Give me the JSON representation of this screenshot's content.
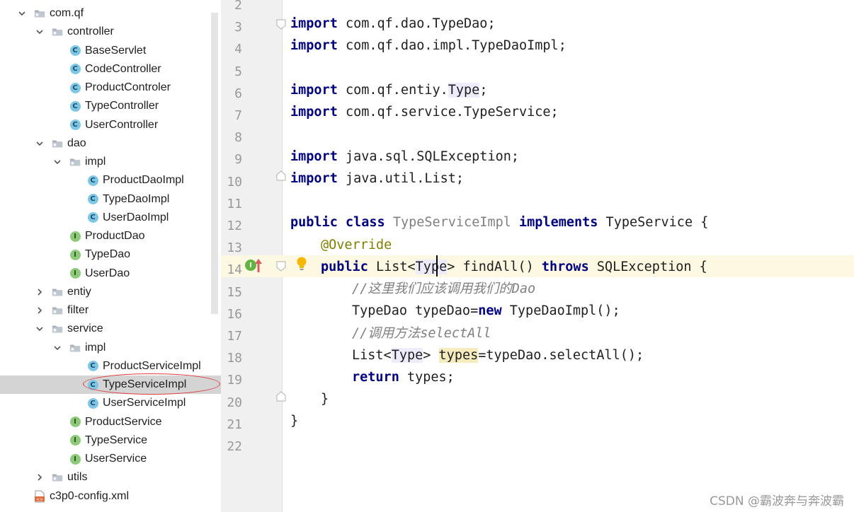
{
  "tree": {
    "items": [
      {
        "label": "com.qf",
        "kind": "package",
        "arrow": "down"
      },
      {
        "label": "controller",
        "kind": "package",
        "arrow": "down"
      },
      {
        "label": "BaseServlet",
        "kind": "class"
      },
      {
        "label": "CodeController",
        "kind": "class"
      },
      {
        "label": "ProductControler",
        "kind": "class"
      },
      {
        "label": "TypeController",
        "kind": "class"
      },
      {
        "label": "UserController",
        "kind": "class"
      },
      {
        "label": "dao",
        "kind": "package",
        "arrow": "down"
      },
      {
        "label": "impl",
        "kind": "package",
        "arrow": "down"
      },
      {
        "label": "ProductDaoImpl",
        "kind": "class"
      },
      {
        "label": "TypeDaoImpl",
        "kind": "class"
      },
      {
        "label": "UserDaoImpl",
        "kind": "class"
      },
      {
        "label": "ProductDao",
        "kind": "interface"
      },
      {
        "label": "TypeDao",
        "kind": "interface"
      },
      {
        "label": "UserDao",
        "kind": "interface"
      },
      {
        "label": "entiy",
        "kind": "package",
        "arrow": "right"
      },
      {
        "label": "filter",
        "kind": "package",
        "arrow": "right"
      },
      {
        "label": "service",
        "kind": "package",
        "arrow": "down"
      },
      {
        "label": "impl",
        "kind": "package",
        "arrow": "down"
      },
      {
        "label": "ProductServiceImpl",
        "kind": "class"
      },
      {
        "label": "TypeServiceImpl",
        "kind": "class",
        "selected": true
      },
      {
        "label": "UserServiceImpl",
        "kind": "class"
      },
      {
        "label": "ProductService",
        "kind": "interface"
      },
      {
        "label": "TypeService",
        "kind": "interface"
      },
      {
        "label": "UserService",
        "kind": "interface"
      },
      {
        "label": "utils",
        "kind": "package",
        "arrow": "right"
      },
      {
        "label": "c3p0-config.xml",
        "kind": "xml"
      }
    ],
    "class_badge": "C",
    "interface_badge": "I"
  },
  "editor": {
    "line_numbers": [
      "2",
      "3",
      "4",
      "5",
      "6",
      "7",
      "8",
      "9",
      "10",
      "11",
      "12",
      "13",
      "14",
      "15",
      "16",
      "17",
      "18",
      "19",
      "20",
      "21",
      "22"
    ],
    "current_line": "14",
    "lines": {
      "l3_kw": "import",
      "l3_rest": " com.qf.dao.TypeDao;",
      "l4_kw": "import",
      "l4_rest": " com.qf.dao.impl.TypeDaoImpl;",
      "l6_kw": "import",
      "l6_a": " com.qf.entiy.",
      "l6_type": "Type",
      "l6_end": ";",
      "l7_kw": "import",
      "l7_rest": " com.qf.service.TypeService;",
      "l9_kw": "import",
      "l9_rest": " java.sql.SQLException;",
      "l10_kw": "import",
      "l10_rest": " java.util.List;",
      "l12_kw1": "public",
      "l12_kw2": "class",
      "l12_name": "TypeServiceImpl",
      "l12_kw3": "implements",
      "l12_rest": " TypeService {",
      "l13_ann": "@Override",
      "l14_kw": "public",
      "l14_a": " List<",
      "l14_type": "Type",
      "l14_b": "> findAll() ",
      "l14_kw2": "throws",
      "l14_rest": " SQLException {",
      "l15_cmt": "//这里我们应该调用我们的Dao",
      "l16_a": "TypeDao typeDao=",
      "l16_kw": "new",
      "l16_rest": " TypeDaoImpl();",
      "l17_cmt": "//调用方法selectAll",
      "l18_a": "List<",
      "l18_type": "Type",
      "l18_b": "> ",
      "l18_var": "types",
      "l18_rest": "=typeDao.selectAll();",
      "l19_kw": "return",
      "l19_rest": " types;",
      "l20": "}",
      "l21": "}"
    }
  },
  "watermark": "CSDN @霸波奔与奔波霸",
  "colors": {
    "keyword": "#000080",
    "annotation": "#808000",
    "comment": "#808080",
    "selection": "#d4d4d4",
    "caret_row": "#fcf8e1",
    "class_icon": "#7dc6e6",
    "interface_icon": "#8ec97a",
    "highlight_ellipse": "#e23c3c"
  }
}
